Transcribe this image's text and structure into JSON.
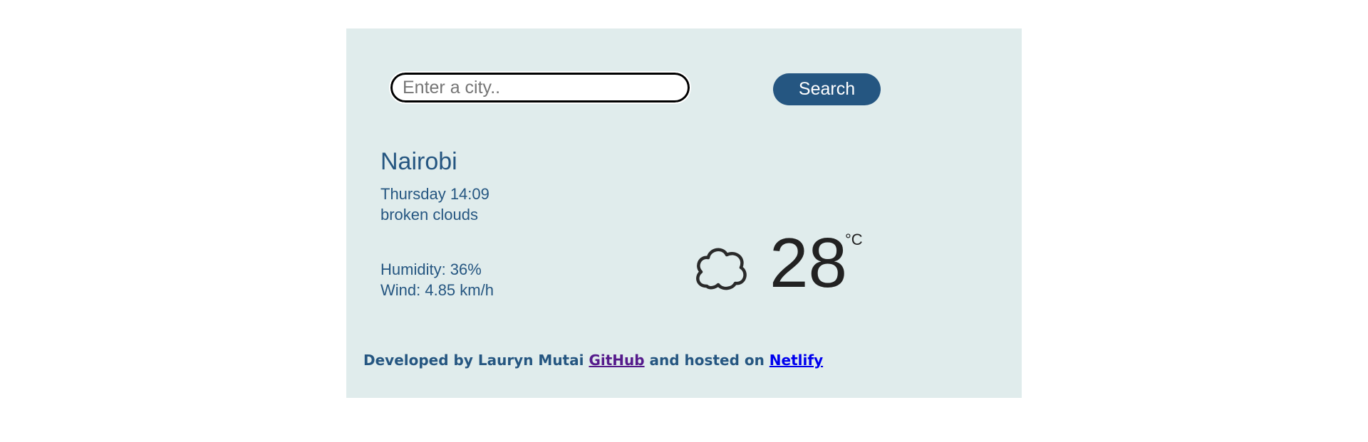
{
  "search": {
    "placeholder": "Enter a city..",
    "value": "",
    "button_label": "Search"
  },
  "weather": {
    "city": "Nairobi",
    "day_time": "Thursday 14:09",
    "description": "broken clouds",
    "humidity": "Humidity: 36%",
    "wind": "Wind: 4.85 km/h",
    "temperature": "28",
    "unit": "°C",
    "icon": "cloud-icon"
  },
  "footer": {
    "text_1": "Developed by Lauryn Mutai",
    "github_label": "GitHub",
    "text_2": "and hosted on",
    "netlify_label": "Netlify"
  },
  "colors": {
    "panel_background": "#e0ecec",
    "accent": "#255681",
    "visited_link": "#551a8b",
    "link": "#0000ee"
  }
}
